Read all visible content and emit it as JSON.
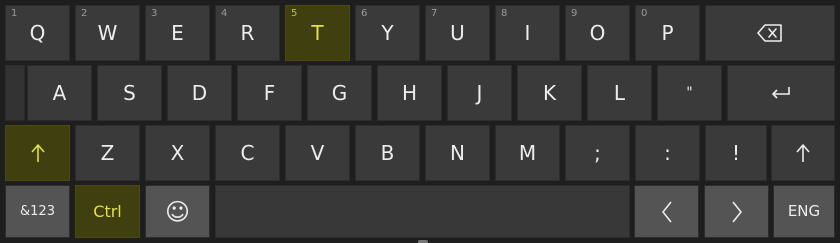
{
  "keyboard": {
    "row1": [
      {
        "num": "1",
        "label": "Q"
      },
      {
        "num": "2",
        "label": "W"
      },
      {
        "num": "3",
        "label": "E"
      },
      {
        "num": "4",
        "label": "R"
      },
      {
        "num": "5",
        "label": "T"
      },
      {
        "num": "6",
        "label": "Y"
      },
      {
        "num": "7",
        "label": "U"
      },
      {
        "num": "8",
        "label": "I"
      },
      {
        "num": "9",
        "label": "O"
      },
      {
        "num": "0",
        "label": "P"
      }
    ],
    "row2": [
      "A",
      "S",
      "D",
      "F",
      "G",
      "H",
      "J",
      "K",
      "L",
      "\""
    ],
    "row3": [
      "Z",
      "X",
      "C",
      "V",
      "B",
      "N",
      "M",
      ";",
      ":",
      "!"
    ],
    "bottom": {
      "symbols_label": "&123",
      "ctrl_label": "Ctrl",
      "emoji_label": "☺",
      "language_label": "ENG"
    },
    "icons": {
      "backspace": "backspace-icon",
      "enter": "enter-icon",
      "shift": "shift-arrow-up-icon",
      "up": "arrow-up-icon",
      "left": "chevron-left-icon",
      "right": "chevron-right-icon"
    },
    "colors": {
      "key": "#3a3a3a",
      "active_key": "#3f3f10",
      "active_text": "#e0e04a",
      "text": "#ececec"
    },
    "active_keys": [
      "T",
      "shift",
      "Ctrl"
    ]
  }
}
